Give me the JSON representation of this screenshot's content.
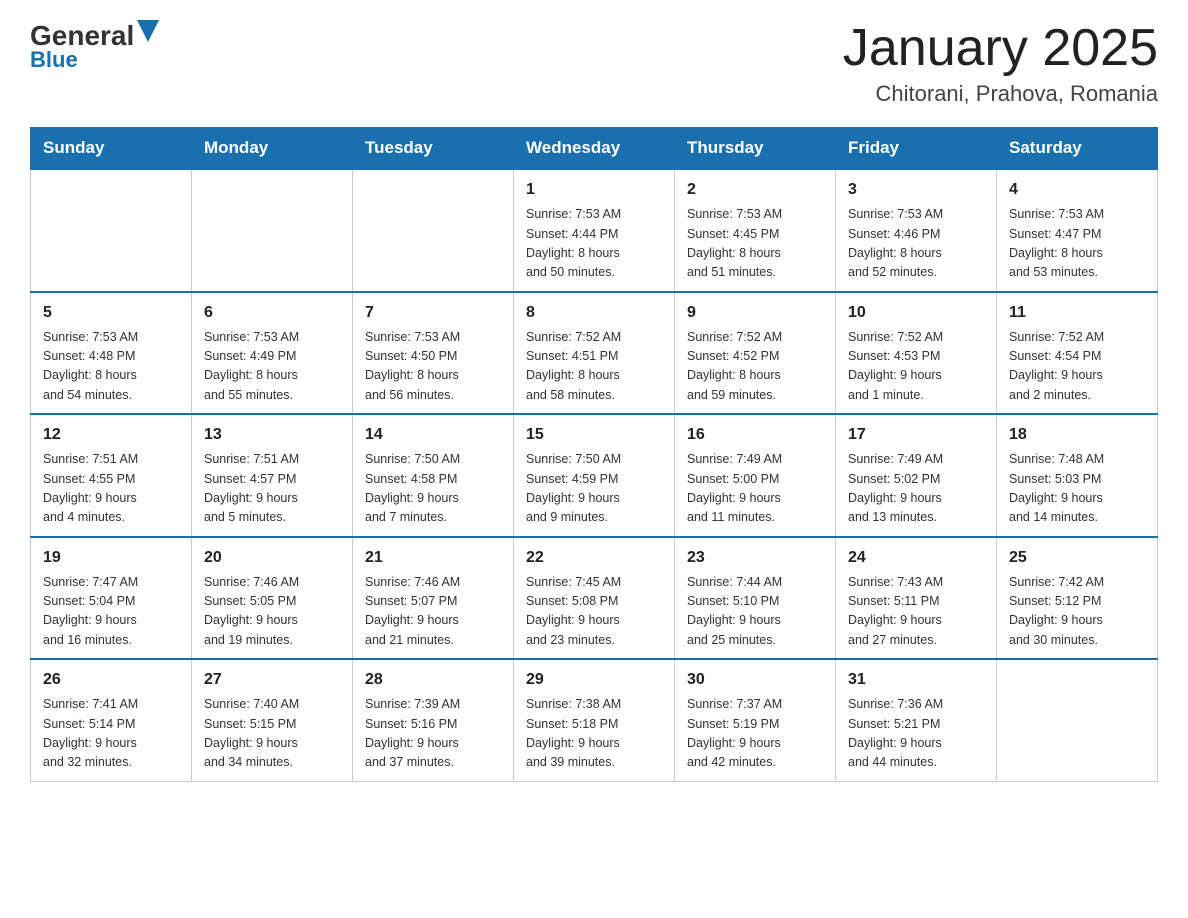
{
  "logo": {
    "text1": "General",
    "text2": "Blue"
  },
  "title": "January 2025",
  "subtitle": "Chitorani, Prahova, Romania",
  "days_of_week": [
    "Sunday",
    "Monday",
    "Tuesday",
    "Wednesday",
    "Thursday",
    "Friday",
    "Saturday"
  ],
  "weeks": [
    [
      {
        "day": "",
        "info": ""
      },
      {
        "day": "",
        "info": ""
      },
      {
        "day": "",
        "info": ""
      },
      {
        "day": "1",
        "info": "Sunrise: 7:53 AM\nSunset: 4:44 PM\nDaylight: 8 hours\nand 50 minutes."
      },
      {
        "day": "2",
        "info": "Sunrise: 7:53 AM\nSunset: 4:45 PM\nDaylight: 8 hours\nand 51 minutes."
      },
      {
        "day": "3",
        "info": "Sunrise: 7:53 AM\nSunset: 4:46 PM\nDaylight: 8 hours\nand 52 minutes."
      },
      {
        "day": "4",
        "info": "Sunrise: 7:53 AM\nSunset: 4:47 PM\nDaylight: 8 hours\nand 53 minutes."
      }
    ],
    [
      {
        "day": "5",
        "info": "Sunrise: 7:53 AM\nSunset: 4:48 PM\nDaylight: 8 hours\nand 54 minutes."
      },
      {
        "day": "6",
        "info": "Sunrise: 7:53 AM\nSunset: 4:49 PM\nDaylight: 8 hours\nand 55 minutes."
      },
      {
        "day": "7",
        "info": "Sunrise: 7:53 AM\nSunset: 4:50 PM\nDaylight: 8 hours\nand 56 minutes."
      },
      {
        "day": "8",
        "info": "Sunrise: 7:52 AM\nSunset: 4:51 PM\nDaylight: 8 hours\nand 58 minutes."
      },
      {
        "day": "9",
        "info": "Sunrise: 7:52 AM\nSunset: 4:52 PM\nDaylight: 8 hours\nand 59 minutes."
      },
      {
        "day": "10",
        "info": "Sunrise: 7:52 AM\nSunset: 4:53 PM\nDaylight: 9 hours\nand 1 minute."
      },
      {
        "day": "11",
        "info": "Sunrise: 7:52 AM\nSunset: 4:54 PM\nDaylight: 9 hours\nand 2 minutes."
      }
    ],
    [
      {
        "day": "12",
        "info": "Sunrise: 7:51 AM\nSunset: 4:55 PM\nDaylight: 9 hours\nand 4 minutes."
      },
      {
        "day": "13",
        "info": "Sunrise: 7:51 AM\nSunset: 4:57 PM\nDaylight: 9 hours\nand 5 minutes."
      },
      {
        "day": "14",
        "info": "Sunrise: 7:50 AM\nSunset: 4:58 PM\nDaylight: 9 hours\nand 7 minutes."
      },
      {
        "day": "15",
        "info": "Sunrise: 7:50 AM\nSunset: 4:59 PM\nDaylight: 9 hours\nand 9 minutes."
      },
      {
        "day": "16",
        "info": "Sunrise: 7:49 AM\nSunset: 5:00 PM\nDaylight: 9 hours\nand 11 minutes."
      },
      {
        "day": "17",
        "info": "Sunrise: 7:49 AM\nSunset: 5:02 PM\nDaylight: 9 hours\nand 13 minutes."
      },
      {
        "day": "18",
        "info": "Sunrise: 7:48 AM\nSunset: 5:03 PM\nDaylight: 9 hours\nand 14 minutes."
      }
    ],
    [
      {
        "day": "19",
        "info": "Sunrise: 7:47 AM\nSunset: 5:04 PM\nDaylight: 9 hours\nand 16 minutes."
      },
      {
        "day": "20",
        "info": "Sunrise: 7:46 AM\nSunset: 5:05 PM\nDaylight: 9 hours\nand 19 minutes."
      },
      {
        "day": "21",
        "info": "Sunrise: 7:46 AM\nSunset: 5:07 PM\nDaylight: 9 hours\nand 21 minutes."
      },
      {
        "day": "22",
        "info": "Sunrise: 7:45 AM\nSunset: 5:08 PM\nDaylight: 9 hours\nand 23 minutes."
      },
      {
        "day": "23",
        "info": "Sunrise: 7:44 AM\nSunset: 5:10 PM\nDaylight: 9 hours\nand 25 minutes."
      },
      {
        "day": "24",
        "info": "Sunrise: 7:43 AM\nSunset: 5:11 PM\nDaylight: 9 hours\nand 27 minutes."
      },
      {
        "day": "25",
        "info": "Sunrise: 7:42 AM\nSunset: 5:12 PM\nDaylight: 9 hours\nand 30 minutes."
      }
    ],
    [
      {
        "day": "26",
        "info": "Sunrise: 7:41 AM\nSunset: 5:14 PM\nDaylight: 9 hours\nand 32 minutes."
      },
      {
        "day": "27",
        "info": "Sunrise: 7:40 AM\nSunset: 5:15 PM\nDaylight: 9 hours\nand 34 minutes."
      },
      {
        "day": "28",
        "info": "Sunrise: 7:39 AM\nSunset: 5:16 PM\nDaylight: 9 hours\nand 37 minutes."
      },
      {
        "day": "29",
        "info": "Sunrise: 7:38 AM\nSunset: 5:18 PM\nDaylight: 9 hours\nand 39 minutes."
      },
      {
        "day": "30",
        "info": "Sunrise: 7:37 AM\nSunset: 5:19 PM\nDaylight: 9 hours\nand 42 minutes."
      },
      {
        "day": "31",
        "info": "Sunrise: 7:36 AM\nSunset: 5:21 PM\nDaylight: 9 hours\nand 44 minutes."
      },
      {
        "day": "",
        "info": ""
      }
    ]
  ]
}
